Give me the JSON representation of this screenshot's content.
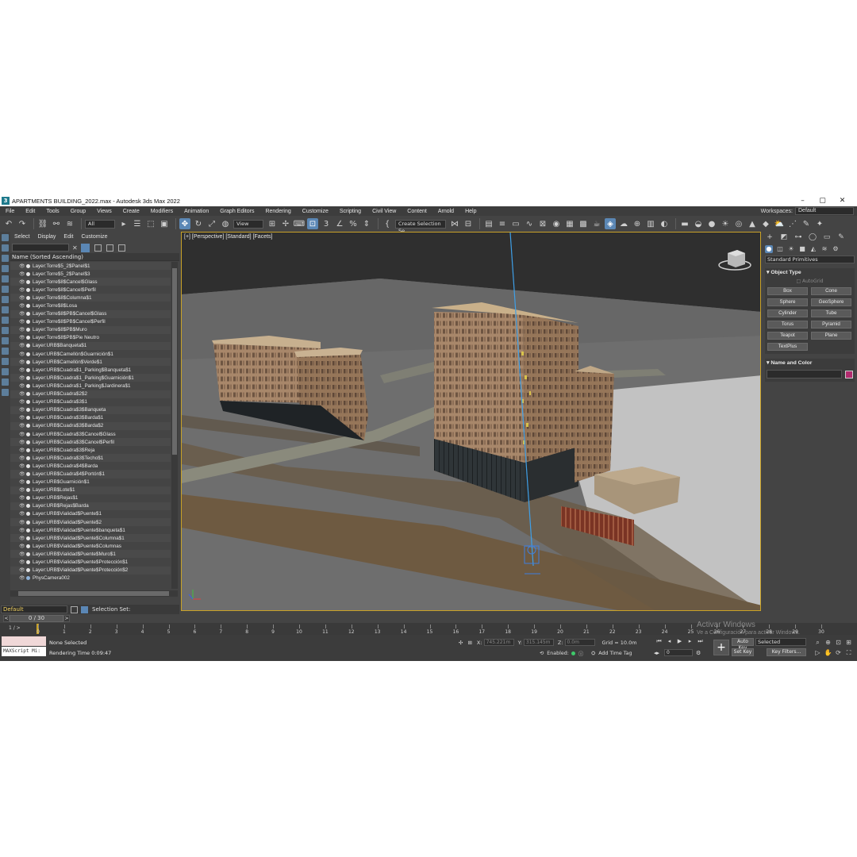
{
  "window": {
    "title": "APARTMENTS BUILDING_2022.max - Autodesk 3ds Max 2022",
    "controls": [
      "–",
      "▢",
      "✕"
    ]
  },
  "menu": [
    "File",
    "Edit",
    "Tools",
    "Group",
    "Views",
    "Create",
    "Modifiers",
    "Animation",
    "Graph Editors",
    "Rendering",
    "Customize",
    "Scripting",
    "Civil View",
    "Content",
    "Arnold",
    "Help"
  ],
  "workspaces": {
    "label": "Workspaces:",
    "value": "Default"
  },
  "toolbar": {
    "selection_filter": "All",
    "ref_coord": "View",
    "named_selection": "Create Selection Se"
  },
  "explorer": {
    "tabs": [
      "Select",
      "Display",
      "Edit",
      "Customize"
    ],
    "column_header": "Name (Sorted Ascending)",
    "items": [
      "Layer:Torre$5_2$Panel$1",
      "Layer:Torre$5_2$Panel$3",
      "Layer:Torre$8$Cancel$Glass",
      "Layer:Torre$8$Cancel$Perfil",
      "Layer:Torre$8$Columna$1",
      "Layer:Torre$8$Losa",
      "Layer:Torre$8$PB$Cancel$Glass",
      "Layer:Torre$8$PB$Cancel$Perfil",
      "Layer:Torre$8$PB$Muro",
      "Layer:Torre$8$PB$Pie Neutro",
      "Layer:URB$Banqueta$1",
      "Layer:URB$Camellón$Guarnición$1",
      "Layer:URB$Camellón$Verde$1",
      "Layer:URB$Cuadra$1_Parking$Banqueta$1",
      "Layer:URB$Cuadra$1_Parking$Guarnición$1",
      "Layer:URB$Cuadra$1_Parking$Jardinera$1",
      "Layer:URB$Cuadra$2$2",
      "Layer:URB$Cuadra$3$1",
      "Layer:URB$Cuadra$3$Banqueta",
      "Layer:URB$Cuadra$3$Barda$1",
      "Layer:URB$Cuadra$3$Barda$2",
      "Layer:URB$Cuadra$3$Cancel$Glass",
      "Layer:URB$Cuadra$3$Cancel$Perfil",
      "Layer:URB$Cuadra$3$Reja",
      "Layer:URB$Cuadra$3$Techo$1",
      "Layer:URB$Cuadra$4$Barda",
      "Layer:URB$Cuadra$4$Portón$1",
      "Layer:URB$Guarnición$1",
      "Layer:URB$Lote$1",
      "Layer:URB$Rejas$1",
      "Layer:URB$Rejas$Barda",
      "Layer:URB$Vialidad$Puente$1",
      "Layer:URB$Vialidad$Puente$2",
      "Layer:URB$Vialidad$Puente$banqueta$1",
      "Layer:URB$Vialidad$Puente$Columna$1",
      "Layer:URB$Vialidad$Puente$Columnas",
      "Layer:URB$Vialidad$Puente$Muro$1",
      "Layer:URB$Vialidad$Puente$Protección$1",
      "Layer:URB$Vialidad$Puente$Protección$2",
      "PhysCamera002"
    ]
  },
  "layer_bar": {
    "layer": "Default",
    "selection_set_label": "Selection Set:"
  },
  "frame_counter": "0 / 30",
  "viewport": {
    "label": "[+] [Perspective] [Standard] [Facets]"
  },
  "command_panel": {
    "dropdown": "Standard Primitives",
    "object_type_title": "Object Type",
    "autogrid": "AutoGrid",
    "primitives": [
      "Box",
      "Cone",
      "Sphere",
      "GeoSphere",
      "Cylinder",
      "Tube",
      "Torus",
      "Pyramid",
      "Teapot",
      "Plane",
      "TextPlus"
    ],
    "name_color_title": "Name and Color",
    "swatch_color": "#b22b6e"
  },
  "timeline": {
    "frame_indicator": "1 / >",
    "ticks": [
      "0",
      "1",
      "2",
      "3",
      "4",
      "5",
      "6",
      "7",
      "8",
      "9",
      "10",
      "11",
      "12",
      "13",
      "14",
      "15",
      "16",
      "17",
      "18",
      "19",
      "20",
      "21",
      "22",
      "23",
      "24",
      "25",
      "26",
      "27",
      "28",
      "29",
      "30"
    ]
  },
  "status": {
    "maxscript": "MAXScript Mi:",
    "selection": "None Selected",
    "render_time": "Rendering Time  0:09:47",
    "x_label": "X:",
    "x_value": "745.221m",
    "y_label": "Y:",
    "y_value": "315.145m",
    "z_label": "Z:",
    "z_value": "0.0m",
    "grid": "Grid = 10.0m",
    "enabled": "Enabled:",
    "add_time_tag": "Add Time Tag",
    "auto_key": "Auto Key",
    "set_key": "Set Key",
    "key_mode": "Selected",
    "key_filters": "Key Filters...",
    "current_frame": "0"
  },
  "watermark": {
    "line1": "Activar Windows",
    "line2": "Ve a Configuración para activar Windows."
  },
  "colors": {
    "ui_bg": "#444444",
    "accent": "#5b87b5",
    "viewport_border": "#c9a227",
    "building_tan": "#a8876a"
  }
}
